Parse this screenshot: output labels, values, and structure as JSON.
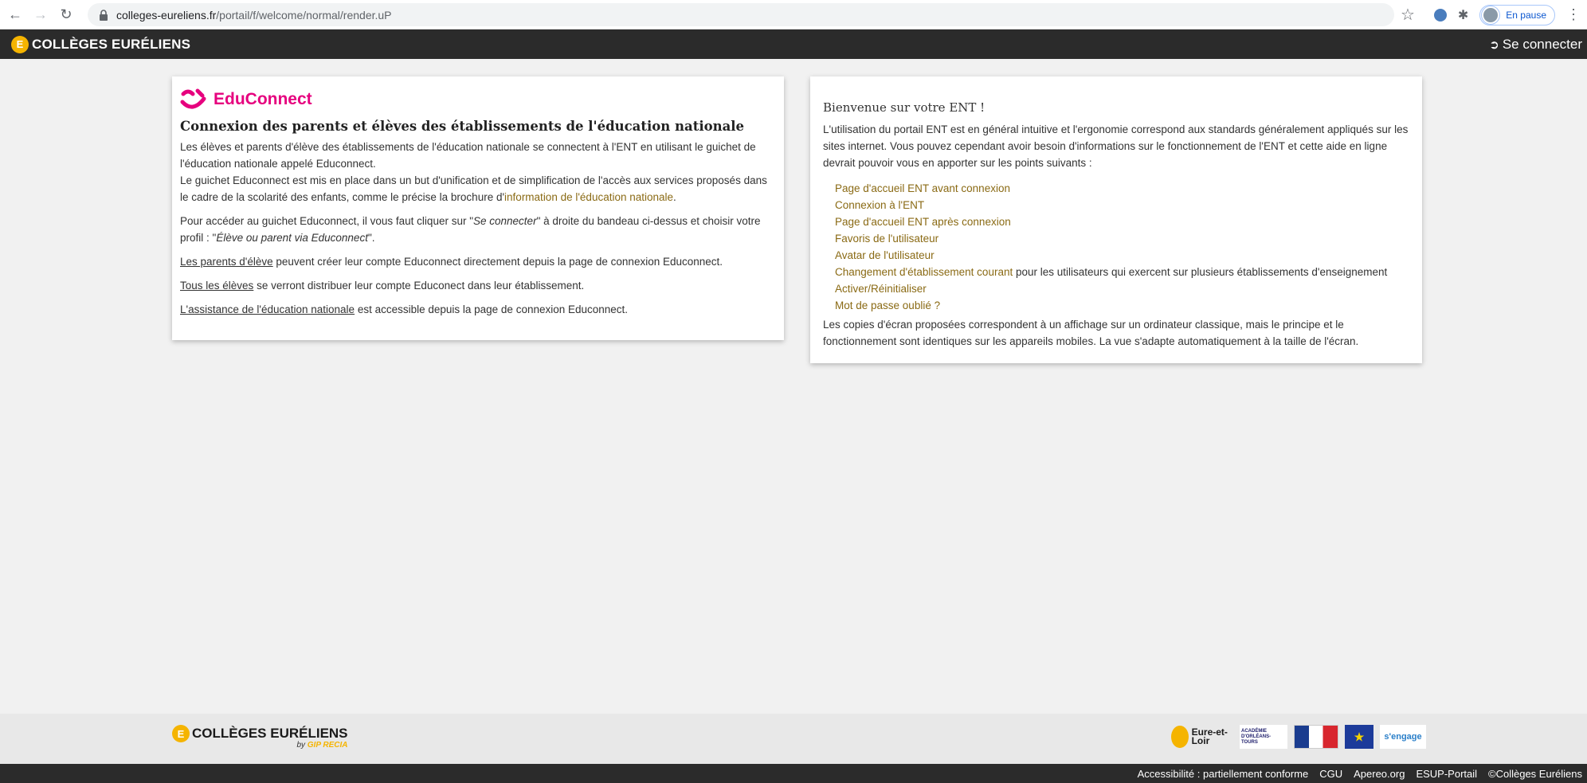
{
  "browser": {
    "url_host": "colleges-eureliens.fr",
    "url_path": "/portail/f/welcome/normal/render.uP",
    "profile_status": "En pause"
  },
  "header": {
    "brand_logo_letter": "E",
    "brand": "COLLÈGES EURÉLIENS",
    "login_label": "Se connecter"
  },
  "educonnect": {
    "logo_text": "EduConnect",
    "heading": "Connexion des parents et élèves des établissements de l'éducation nationale",
    "p1_line1": "Les élèves et parents d'élève des établissements de l'éducation nationale se connectent à l'ENT en utilisant le guichet de l'éducation nationale appelé Educonnect.",
    "p1_line2": "Le guichet Educonnect est mis en place dans un but d'unification et de simplification de l'accès aux services proposés dans le cadre de la scolarité des enfants, comme le précise la brochure d'",
    "p1_link": "information de l'éducation nationale",
    "p1_end": ".",
    "p2_a": "Pour accéder au guichet Educonnect, il vous faut cliquer sur \"",
    "p2_em1": "Se connecter",
    "p2_b": "\" à droite du bandeau ci-dessus et choisir votre profil : \"",
    "p2_em2": "Élève ou parent via Educonnect",
    "p2_c": "\".",
    "p3_link": "Les parents d'élève",
    "p3_text": " peuvent créer leur compte Educonnect directement depuis la page de connexion Educonnect.",
    "p4_link": "Tous les élèves",
    "p4_text": " se verront distribuer leur compte Educonect dans leur établissement.",
    "p5_link": "L'assistance de l'éducation nationale",
    "p5_text": " est accessible depuis la page de connexion Educonnect."
  },
  "welcome": {
    "title": "Bienvenue sur votre ENT !",
    "intro": "L'utilisation du portail ENT est en général intuitive et l'ergonomie correspond aux standards généralement appliqués sur les sites internet. Vous pouvez cependant avoir besoin d'informations sur le fonctionnement de l'ENT et cette aide en ligne devrait pouvoir vous en apporter sur les points suivants :",
    "links": [
      {
        "label": "Page d'accueil ENT avant connexion",
        "suffix": ""
      },
      {
        "label": "Connexion à l'ENT",
        "suffix": ""
      },
      {
        "label": "Page d'accueil ENT après connexion",
        "suffix": ""
      },
      {
        "label": "Favoris de l'utilisateur",
        "suffix": ""
      },
      {
        "label": "Avatar de l'utilisateur",
        "suffix": ""
      },
      {
        "label": "Changement d'établissement courant",
        "suffix": " pour les utilisateurs qui exercent sur plusieurs établissements d'enseignement"
      },
      {
        "label": "Activer/Réinitialiser",
        "suffix": ""
      },
      {
        "label": "Mot de passe oublié ?",
        "suffix": ""
      }
    ],
    "outro": "Les copies d'écran proposées correspondent à un affichage sur un ordinateur classique, mais le principe et le fonctionnement sont identiques sur les appareils mobiles. La vue s'adapte automatiquement à la taille de l'écran."
  },
  "footer": {
    "brand_logo_letter": "E",
    "brand": "COLLÈGES EURÉLIENS",
    "by": "by",
    "by_org": "GIP RECIA",
    "partner_eure": "Eure-et-Loir",
    "partner_acad": "ACADÉMIE D'ORLÉANS-TOURS",
    "partner_eu": "★",
    "partner_engage": "s'engage",
    "links": [
      "Accessibilité : partiellement conforme",
      "CGU",
      "Apereo.org",
      "ESUP-Portail",
      "©Collèges Euréliens"
    ]
  },
  "colors": {
    "header_bg": "#2b2b2b",
    "brand_gold": "#f5b400",
    "educonnect_pink": "#e6007e",
    "link_gold": "#8a6a14"
  }
}
